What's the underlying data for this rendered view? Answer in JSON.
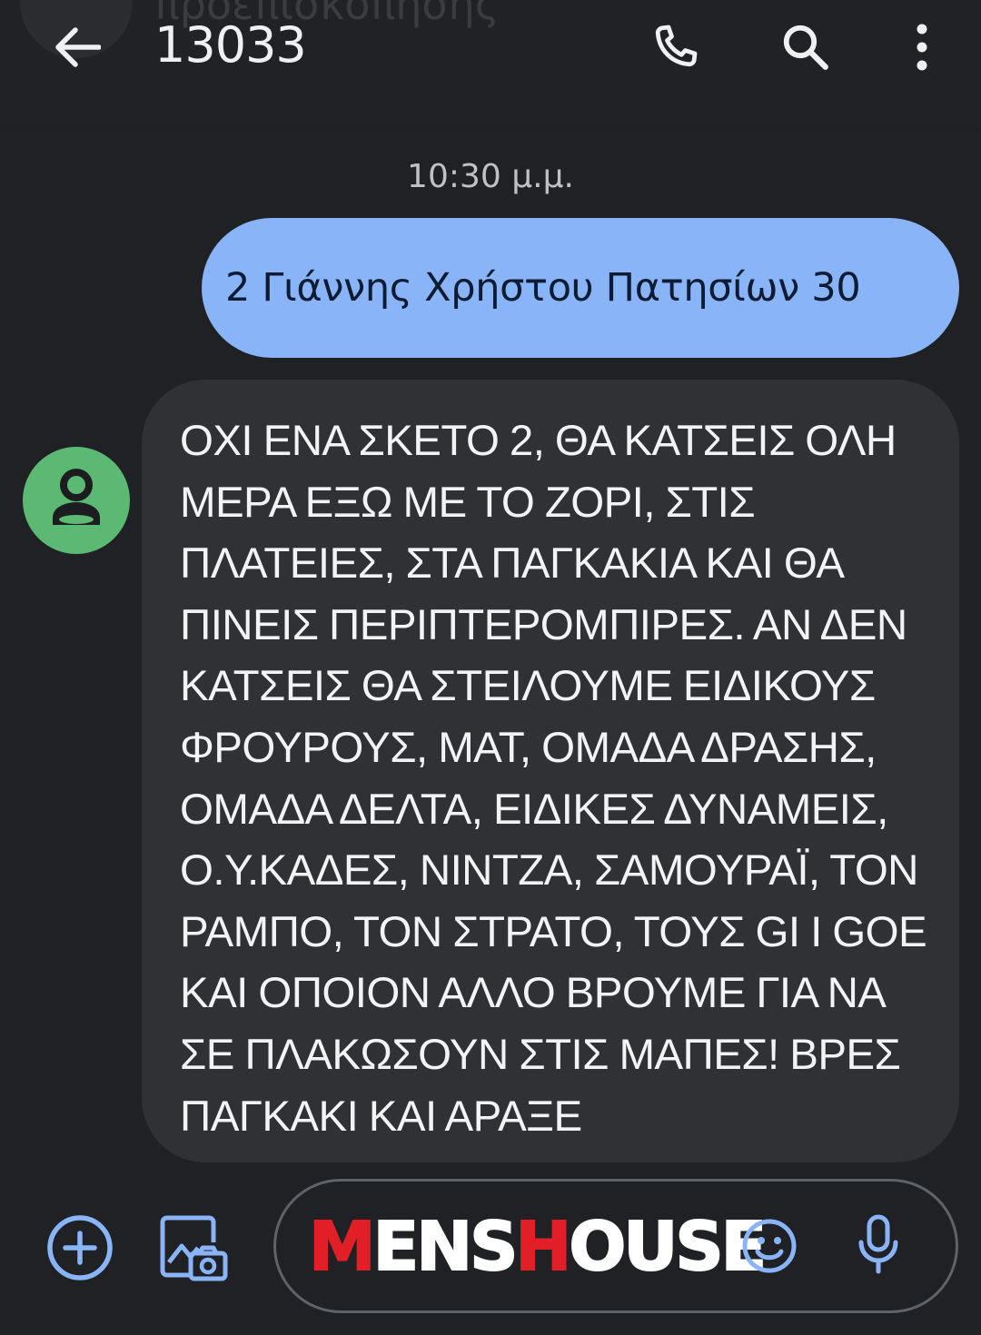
{
  "header": {
    "ghost_text": "προεπισκόπησης",
    "title": "13033",
    "back_icon": "arrow-back-icon",
    "call_icon": "phone-icon",
    "search_icon": "search-icon",
    "menu_icon": "more-vert-icon"
  },
  "conversation": {
    "timestamp": "10:30 μ.μ.",
    "outgoing": {
      "text": "2 Γιάννης Χρήστου Πατησίων 30"
    },
    "incoming": {
      "avatar_icon": "person-icon",
      "text": "ΟΧΙ ΕΝΑ ΣΚΕΤΟ 2, ΘΑ ΚΑΤΣΕΙΣ ΟΛΗ ΜΕΡΑ ΕΞΩ ΜΕ ΤΟ ΖΟΡΙ, ΣΤΙΣ ΠΛΑΤΕΙΕΣ, ΣΤΑ ΠΑΓΚΑΚΙΑ ΚΑΙ ΘΑ ΠΙΝΕΙΣ ΠΕΡΙΠΤΕΡΟΜΠΙΡΕΣ. ΑΝ ΔΕΝ ΚΑΤΣΕΙΣ ΘΑ ΣΤΕΙΛΟΥΜΕ ΕΙΔΙΚΟΥΣ ΦΡΟΥΡΟΥΣ, ΜΑΤ, ΟΜΑΔΑ ΔΡΑΣΗΣ, ΟΜΑΔΑ ΔΕΛΤΑ, ΕΙΔΙΚΕΣ ΔΥΝΑΜΕΙΣ, Ο.Υ.ΚΑΔΕΣ, ΝΙΝΤΖΑ, ΣΑΜΟΥΡΑΪ, ΤΟΝ ΡΑΜΠΟ, ΤΟΝ ΣΤΡΑΤΟ, ΤΟΥΣ GI I GOE ΚΑΙ ΟΠΟΙΟΝ ΑΛΛΟ ΒΡΟΥΜΕ ΓΙΑ ΝΑ ΣΕ ΠΛΑΚΩΣΟΥΝ ΣΤΙΣ ΜΑΠΕΣ! ΒΡΕΣ ΠΑΓΚΑΚΙ ΚΑΙ ΑΡΑΞΕ"
    }
  },
  "composer": {
    "add_icon": "add-circle-icon",
    "gallery_icon": "photo-gallery-icon",
    "watermark": {
      "letters": [
        "M",
        "ENS",
        "H",
        "OUSE"
      ]
    },
    "emoji_icon": "emoji-smile-icon",
    "mic_icon": "mic-icon"
  },
  "colors": {
    "background": "#202124",
    "outgoing_bubble": "#8ab4f8",
    "incoming_bubble": "#303134",
    "avatar": "#5bb974",
    "accent_icons": "#8ab4f8",
    "watermark_red": "#e21f26"
  }
}
